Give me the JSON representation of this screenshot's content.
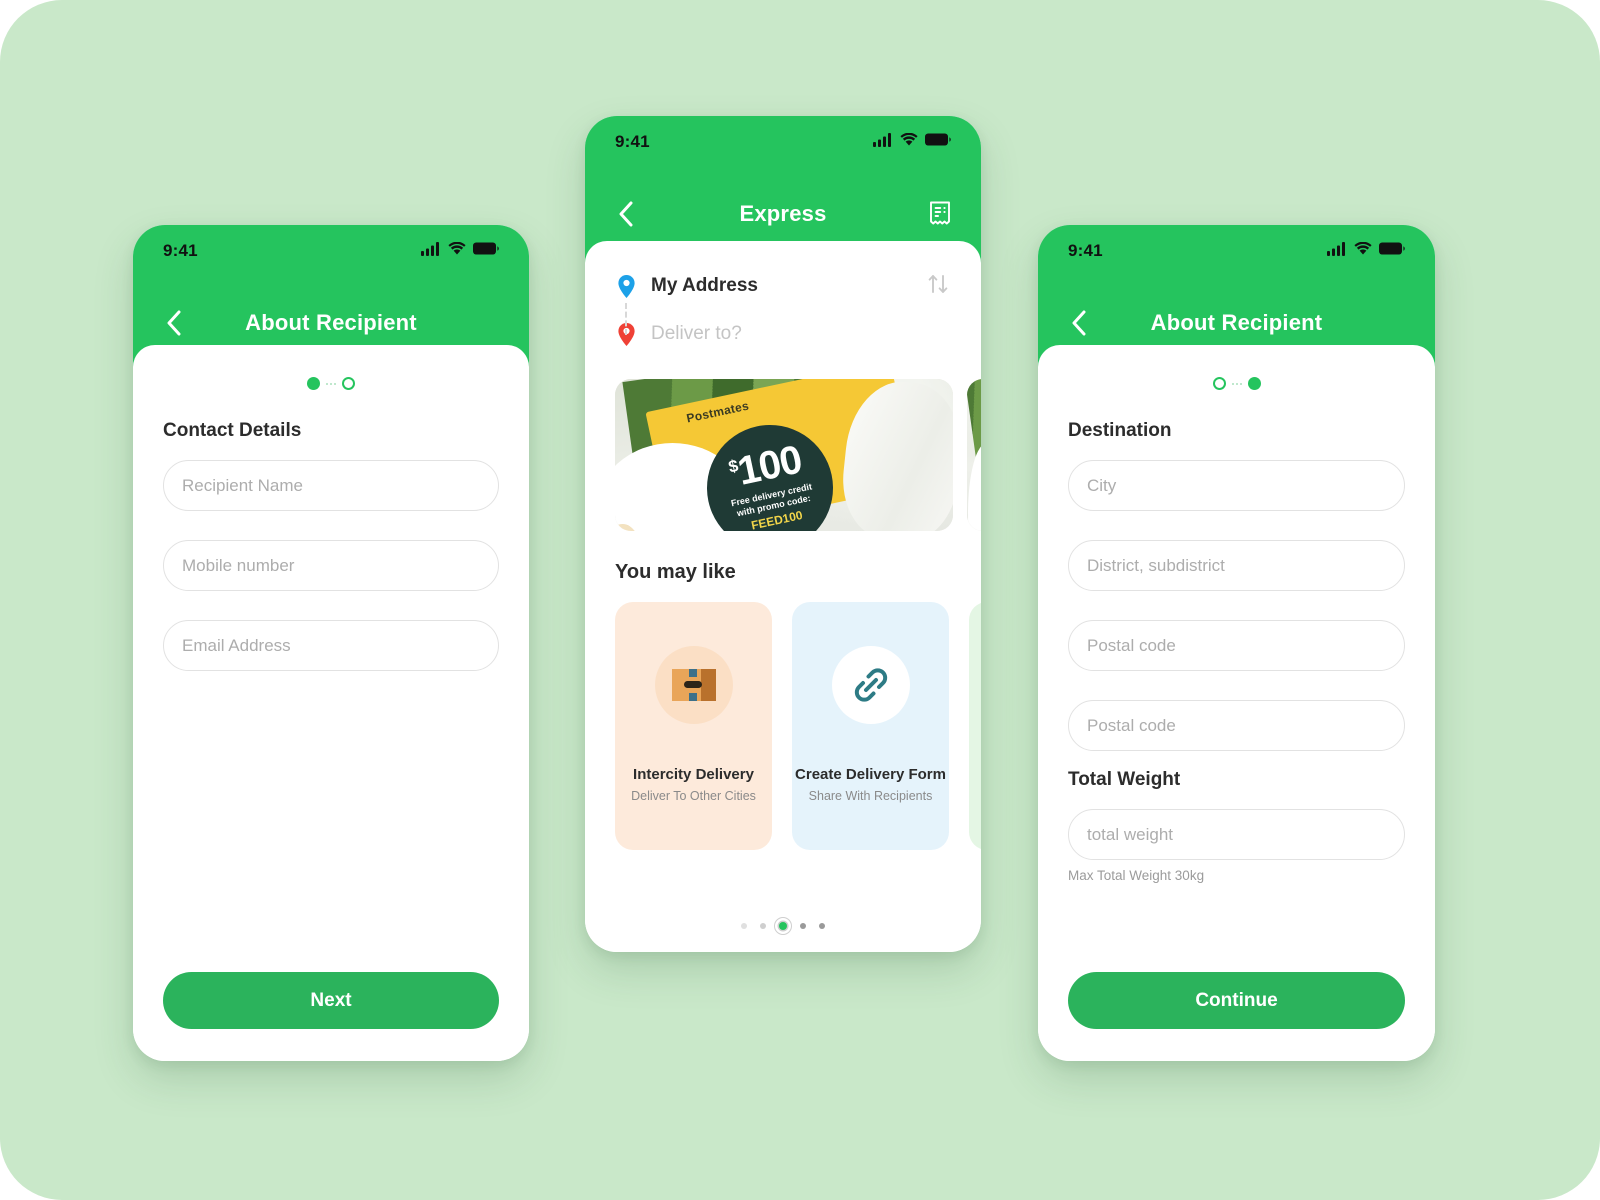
{
  "theme": {
    "background": "#c9e8c9",
    "header_green": "#25c45e",
    "button_green": "#2bb35c",
    "accent_yellow": "#f5c835",
    "badge_dark": "#1f3a35"
  },
  "screen_left": {
    "status": {
      "time": "9:41",
      "signal_icon": "cellular-signal-icon",
      "wifi_icon": "wifi-icon",
      "battery_icon": "battery-icon"
    },
    "nav": {
      "back_icon": "chevron-left-icon",
      "title": "About Recipient"
    },
    "steps": {
      "total": 2,
      "current": 1
    },
    "section_title": "Contact Details",
    "fields": [
      {
        "name": "recipient-name",
        "placeholder": "Recipient Name",
        "value": ""
      },
      {
        "name": "mobile-number",
        "placeholder": "Mobile number",
        "value": ""
      },
      {
        "name": "email-address",
        "placeholder": "Email Address",
        "value": ""
      }
    ],
    "cta_label": "Next"
  },
  "screen_center": {
    "status": {
      "time": "9:41",
      "signal_icon": "cellular-signal-icon",
      "wifi_icon": "wifi-icon",
      "battery_icon": "battery-icon"
    },
    "nav": {
      "back_icon": "chevron-left-icon",
      "title": "Express",
      "action_icon": "receipt-icon"
    },
    "address": {
      "origin_icon": "map-pin-blue-icon",
      "origin_label": "My Address",
      "destination_icon": "map-pin-red-icon",
      "destination_placeholder": "Deliver to?",
      "swap_icon": "swap-vertical-icon"
    },
    "banner": {
      "brand": "Postmates",
      "currency": "$",
      "amount": "100",
      "line1": "Free delivery credit",
      "line2": "with promo code:",
      "promo_code": "FEED100"
    },
    "suggestions_title": "You may like",
    "cards": [
      {
        "name": "intercity-delivery",
        "icon": "package-box-icon",
        "title": "Intercity Delivery",
        "subtitle": "Deliver To Other Cities",
        "color": "#fdeadb"
      },
      {
        "name": "create-delivery-form",
        "icon": "link-chain-icon",
        "title": "Create Delivery Form",
        "subtitle": "Share With Recipients",
        "color": "#e5f3fb"
      },
      {
        "name": "next-suggestion",
        "icon": "",
        "title": "",
        "subtitle": "",
        "color": "#e4f6e4"
      }
    ],
    "pager": {
      "total": 5,
      "current": 3
    }
  },
  "screen_right": {
    "status": {
      "time": "9:41",
      "signal_icon": "cellular-signal-icon",
      "wifi_icon": "wifi-icon",
      "battery_icon": "battery-icon"
    },
    "nav": {
      "back_icon": "chevron-left-icon",
      "title": "About Recipient"
    },
    "steps": {
      "total": 2,
      "current": 2
    },
    "section_title": "Destination",
    "fields": [
      {
        "name": "city",
        "placeholder": "City",
        "value": ""
      },
      {
        "name": "district-subdistrict",
        "placeholder": "District, subdistrict",
        "value": ""
      },
      {
        "name": "postal-code-1",
        "placeholder": "Postal code",
        "value": ""
      },
      {
        "name": "postal-code-2",
        "placeholder": "Postal code",
        "value": ""
      }
    ],
    "weight_title": "Total Weight",
    "weight_field": {
      "name": "total-weight",
      "placeholder": "total weight",
      "value": ""
    },
    "weight_helper": "Max Total Weight 30kg",
    "cta_label": "Continue"
  }
}
